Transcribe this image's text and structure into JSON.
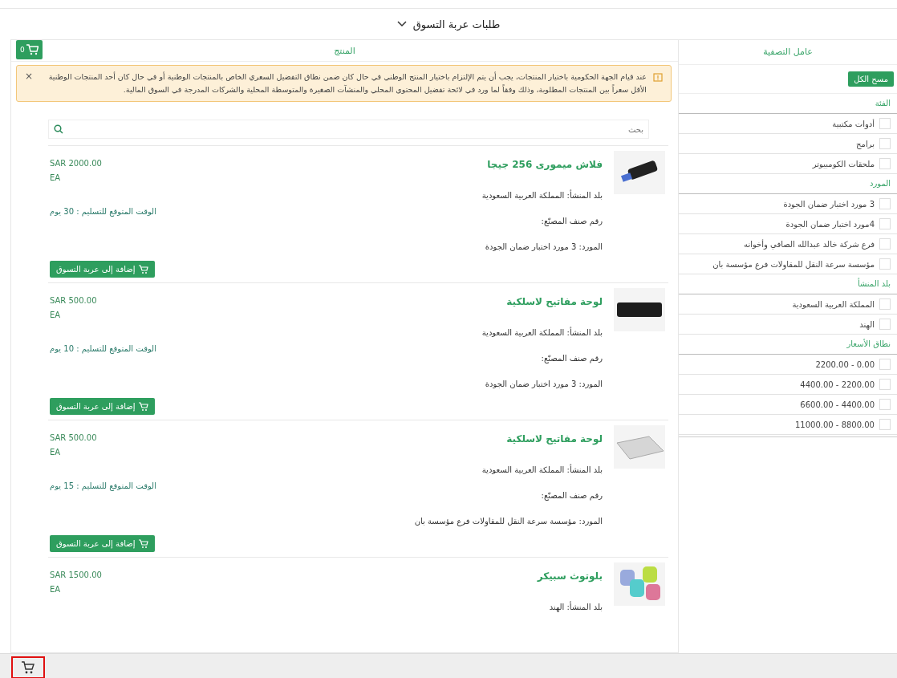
{
  "page_title": "طلبات عربة التسوق",
  "filter_panel": {
    "heading": "عامل التصفية",
    "clear_button": "مسح الكل",
    "sections": [
      {
        "title": "الفئة",
        "options": [
          {
            "label": "أدوات مكتبية",
            "checked": false
          },
          {
            "label": "برامج",
            "checked": false
          },
          {
            "label": "ملحقات الكومبيوتر",
            "checked": false
          }
        ]
      },
      {
        "title": "المورد",
        "options": [
          {
            "label": "3 مورد اختبار ضمان الجودة",
            "checked": false
          },
          {
            "label": "4مورد اختبار ضمان الجودة",
            "checked": false
          },
          {
            "label": "فرع شركة خالد عبدالله الصافي وأخوانه",
            "checked": false
          },
          {
            "label": "مؤسسة سرعة النقل للمقاولات فرع مؤسسة بان",
            "checked": false
          }
        ]
      },
      {
        "title": "بلد المنشأ",
        "options": [
          {
            "label": "المملكة العربية السعودية",
            "checked": false
          },
          {
            "label": "الهند",
            "checked": false
          }
        ]
      },
      {
        "title": "نطاق الأسعار",
        "options": [
          {
            "label": "2200.00 - 0.00",
            "checked": false
          },
          {
            "label": "4400.00 - 2200.00",
            "checked": false
          },
          {
            "label": "6600.00 - 4400.00",
            "checked": false
          },
          {
            "label": "11000.00 - 8800.00",
            "checked": false
          }
        ]
      }
    ]
  },
  "product_panel": {
    "heading": "المنتج",
    "cart_count": "0",
    "notice": "عند قيام الجهة الحكومية باختيار المنتجات، يجب أن يتم الإلتزام باختيار المنتج الوطني في حال كان ضمن نطاق التفضيل السعري الخاص بالمنتجات الوطنية أو في حال كان أحد المنتجات الوطنية الأقل سعراً بين المنتجات المطلوبة، وذلك وفقاً لما ورد في لائحة تفضيل المحتوى المحلي والمنشآت الصغيرة والمتوسطة المحلية والشركات المدرجة في السوق المالية.",
    "notice_close": "×",
    "search_placeholder": "بحث",
    "products": [
      {
        "kind": "flash",
        "name": "فلاش ميمورى 256 جيجا",
        "price": "SAR 2000.00",
        "unit": "EA",
        "origin": "بلد المنشأ: المملكة العربية السعودية",
        "part_number": "رقم صنف المصنّع:",
        "supplier": "المورد: 3 مورد اختبار ضمان الجودة",
        "delivery": "الوقت المتوقع للتسليم : 30 يوم",
        "add_button": "إضافة إلى عربة التسوق"
      },
      {
        "kind": "keyboard-dark",
        "name": "لوحة مفاتيح لاسلكية",
        "price": "SAR 500.00",
        "unit": "EA",
        "origin": "بلد المنشأ: المملكة العربية السعودية",
        "part_number": "رقم صنف المصنّع:",
        "supplier": "المورد: 3 مورد اختبار ضمان الجودة",
        "delivery": "الوقت المتوقع للتسليم : 10 يوم",
        "add_button": "إضافة إلى عربة التسوق"
      },
      {
        "kind": "keyboard-light",
        "name": "لوحة مفاتيح لاسلكية",
        "price": "SAR 500.00",
        "unit": "EA",
        "origin": "بلد المنشأ: المملكة العربية السعودية",
        "part_number": "رقم صنف المصنّع:",
        "supplier": "المورد: مؤسسة سرعة النقل للمقاولات فرع مؤسسة بان",
        "delivery": "الوقت المتوقع للتسليم : 15 يوم",
        "add_button": "إضافة إلى عربة التسوق"
      },
      {
        "kind": "speaker",
        "name": "بلوتوث سبيكر",
        "price": "SAR 1500.00",
        "unit": "EA",
        "origin": "بلد المنشأ: الهند"
      }
    ]
  }
}
